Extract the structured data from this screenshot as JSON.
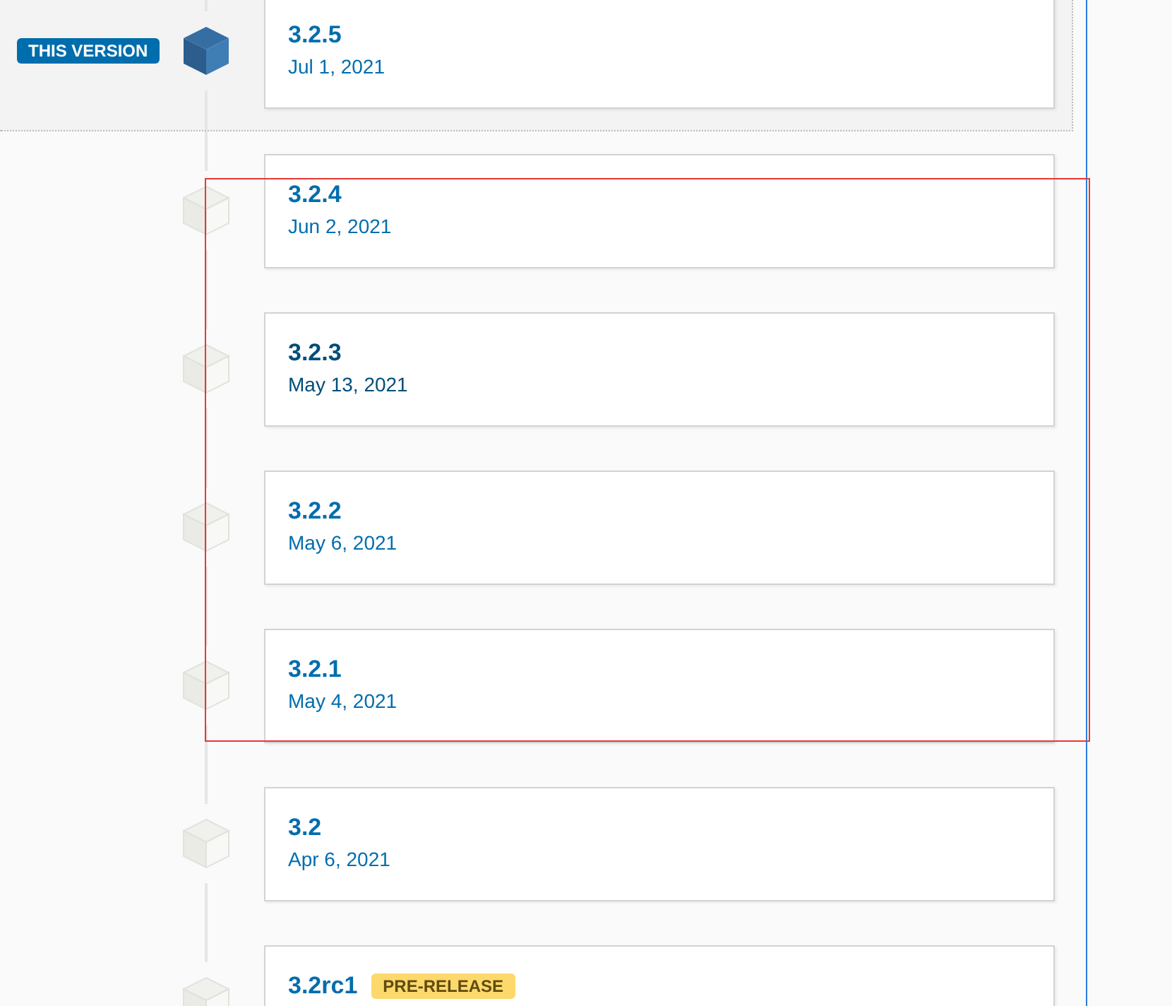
{
  "current_badge": "THIS VERSION",
  "releases": [
    {
      "version": "3.2.5",
      "date": "Jul 1, 2021",
      "current": true,
      "highlighted": false
    },
    {
      "version": "3.2.4",
      "date": "Jun 2, 2021",
      "current": false,
      "highlighted": false
    },
    {
      "version": "3.2.3",
      "date": "May 13, 2021",
      "current": false,
      "highlighted": true
    },
    {
      "version": "3.2.2",
      "date": "May 6, 2021",
      "current": false,
      "highlighted": false
    },
    {
      "version": "3.2.1",
      "date": "May 4, 2021",
      "current": false,
      "highlighted": false
    },
    {
      "version": "3.2",
      "date": "Apr 6, 2021",
      "current": false,
      "highlighted": false
    },
    {
      "version": "3.2rc1",
      "tag": "PRE-RELEASE",
      "current": false,
      "highlighted": false
    }
  ]
}
